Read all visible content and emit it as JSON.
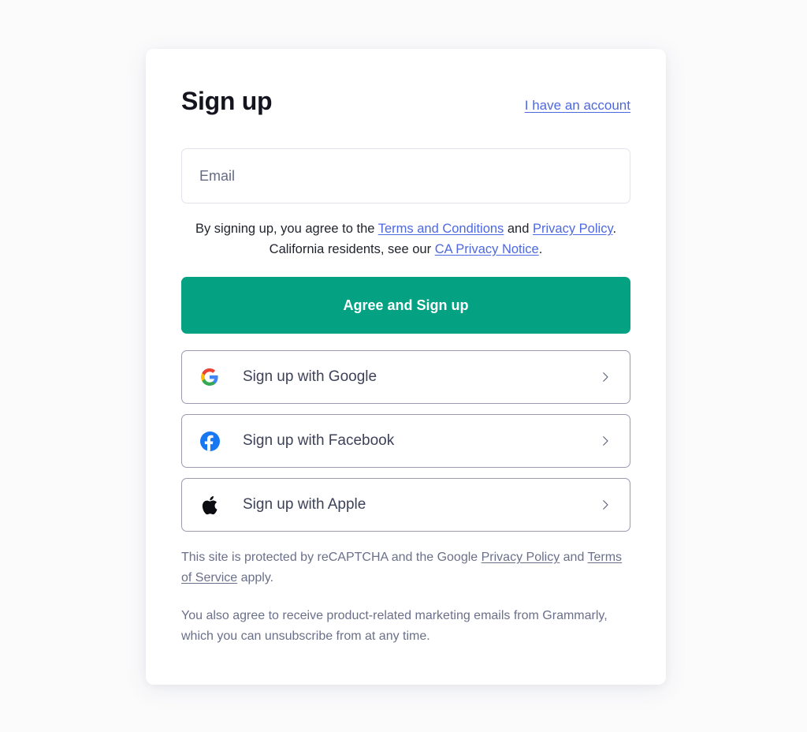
{
  "card": {
    "title": "Sign up",
    "account_link": "I have an account",
    "email": {
      "placeholder": "Email",
      "value": ""
    },
    "terms": {
      "prefix": "By signing up, you agree to the ",
      "terms_link": "Terms and Conditions",
      "middle": " and ",
      "privacy_link": "Privacy Policy",
      "after_privacy": ". California residents, see our ",
      "ca_link": "CA Privacy Notice",
      "suffix": "."
    },
    "cta_label": "Agree and Sign up",
    "social_buttons": [
      {
        "icon": "google-icon",
        "label": "Sign up with Google",
        "chevron": "chevron-right-icon"
      },
      {
        "icon": "facebook-icon",
        "label": "Sign up with Facebook",
        "chevron": "chevron-right-icon"
      },
      {
        "icon": "apple-icon",
        "label": "Sign up with Apple",
        "chevron": "chevron-right-icon"
      }
    ],
    "recaptcha": {
      "prefix": "This site is protected by reCAPTCHA and the Google ",
      "privacy_link": "Privacy Policy",
      "middle": " and ",
      "tos_link": "Terms of Service",
      "suffix": " apply."
    },
    "marketing_notice": "You also agree to receive product-related marketing emails from Grammarly, which you can unsubscribe from at any time."
  },
  "colors": {
    "page_background": "#fbfbfc",
    "card_background": "#ffffff",
    "title": "#14141e",
    "link_blue": "#4d68e0",
    "cta_green": "#04a183",
    "body_text": "#22242e",
    "muted_text": "#6a7089",
    "input_border": "#e3e3ed",
    "social_border": "#9a9bb0",
    "google_red": "#ea4335",
    "google_blue": "#4285f4",
    "google_yellow": "#fbbc05",
    "google_green": "#34a853",
    "facebook_blue": "#1877f2",
    "apple_black": "#0b0b12"
  }
}
